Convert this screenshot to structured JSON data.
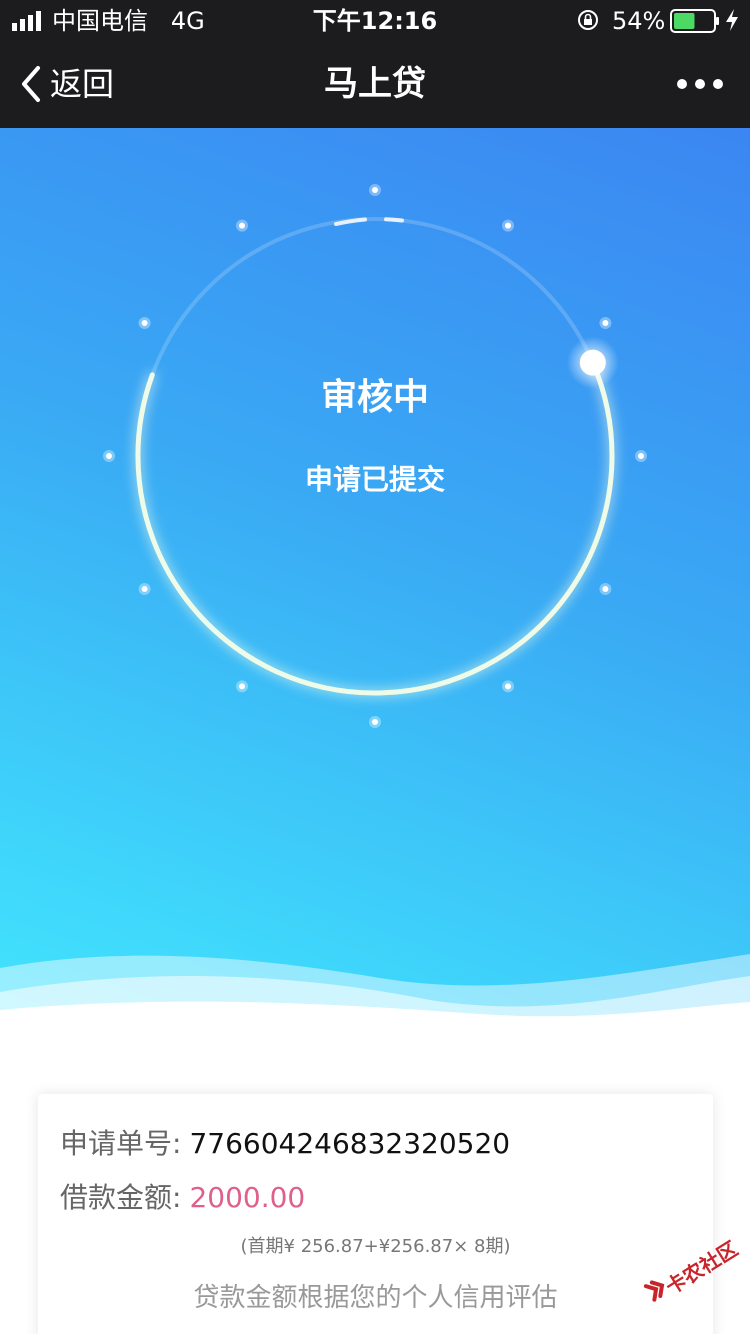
{
  "status_bar": {
    "carrier": "中国电信",
    "network": "4G",
    "time": "下午12:16",
    "battery_percent": "54%",
    "battery_level": 0.54,
    "battery_color": "#4cd964"
  },
  "nav": {
    "back_label": "返回",
    "title": "马上贷",
    "more_icon": "more-dots-icon"
  },
  "progress": {
    "status_title": "审核中",
    "status_subtitle": "申请已提交",
    "progress_fraction": 0.62,
    "gradient_colors": [
      "#3b86f2",
      "#43e4fd"
    ]
  },
  "application": {
    "order_label": "申请单号:",
    "order_number": "776604246832320520",
    "amount_label": "借款金额:",
    "amount_value": "2000.00",
    "amount_color": "#e0608a",
    "installment_text": "(首期¥ 256.87+¥256.87× 8期)",
    "note": "贷款金额根据您的个人信用评估"
  },
  "watermark": {
    "text": "卡农社区"
  }
}
